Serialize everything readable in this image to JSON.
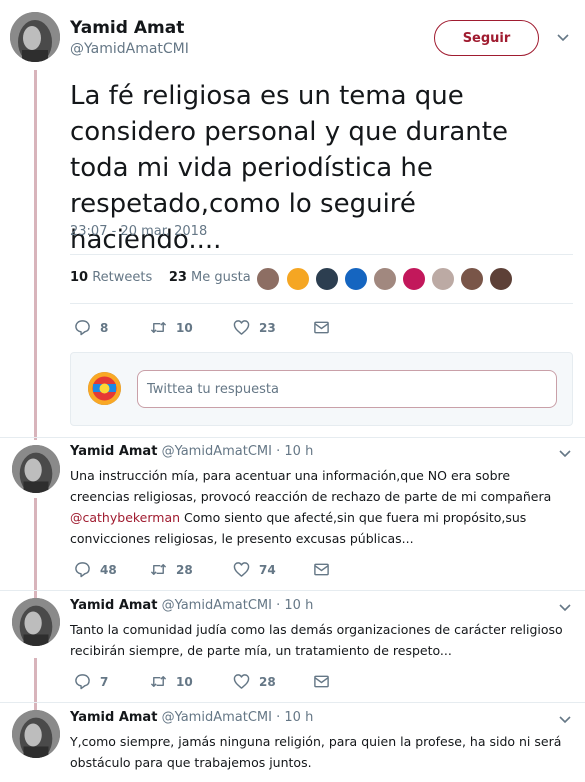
{
  "main_tweet": {
    "author_name": "Yamid Amat",
    "author_handle": "@YamidAmatCMI",
    "follow_label": "Seguir",
    "text": "La fé religiosa es un tema que considero personal y que durante toda mi vida periodística he respetado,como lo seguiré haciendo....",
    "timestamp": "23:07 - 20 mar. 2018",
    "retweets_count": "10",
    "retweets_label": "Retweets",
    "likes_count": "23",
    "likes_label": "Me gusta",
    "actions": {
      "replies": "8",
      "retweets": "10",
      "likes": "23"
    }
  },
  "reply_box": {
    "placeholder": "Twittea tu respuesta"
  },
  "replies": [
    {
      "author_name": "Yamid Amat",
      "author_handle": "@YamidAmatCMI",
      "time_sep": "·",
      "time": "10 h",
      "text_before": "Una instrucción mía, para acentuar una información,que NO era sobre creencias religiosas, provocó reacción de rechazo de parte de mi compañera ",
      "mention": "@cathybekerman",
      "text_after": " Como siento que afecté,sin que fuera mi propósito,sus convicciones religiosas, le presento excusas públicas...",
      "replies": "48",
      "retweets": "28",
      "likes": "74"
    },
    {
      "author_name": "Yamid Amat",
      "author_handle": "@YamidAmatCMI",
      "time_sep": "·",
      "time": "10 h",
      "text": "Tanto la comunidad judía como las demás organizaciones de carácter religioso recibirán siempre, de parte mía, un tratamiento de respeto...",
      "replies": "7",
      "retweets": "10",
      "likes": "28"
    },
    {
      "author_name": "Yamid Amat",
      "author_handle": "@YamidAmatCMI",
      "time_sep": "·",
      "time": "10 h",
      "text": "Y,como siempre, jamás ninguna religión, para quien la profese, ha sido ni será obstáculo para que trabajemos juntos."
    }
  ],
  "colors": {
    "accent": "#a01c30",
    "thread_line": "#d8b4bb",
    "muted_text": "#657786",
    "divider": "#e6ecf0"
  },
  "icons": [
    "avatar",
    "chevron-down-icon",
    "reply-icon",
    "retweet-icon",
    "like-icon",
    "message-icon"
  ]
}
